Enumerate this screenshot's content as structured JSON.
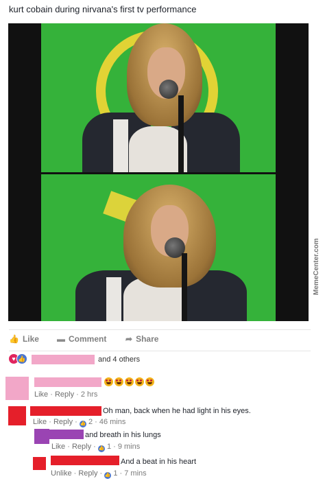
{
  "post": {
    "text": "kurt cobain during nirvana's first tv performance",
    "watermark": "MemeCenter.com"
  },
  "actions": {
    "like": "Like",
    "comment": "Comment",
    "share": "Share"
  },
  "reactions": {
    "others_text": "and 4 others",
    "icons": [
      "love-icon",
      "like-icon"
    ]
  },
  "comments": [
    {
      "text": "",
      "emojis": [
        "heart-eyes-emoji",
        "heart-eyes-emoji",
        "heart-eyes-emoji",
        "heart-eyes-emoji",
        "heart-eyes-emoji"
      ],
      "action_like": "Like",
      "action_reply": "Reply",
      "time": "2 hrs"
    },
    {
      "text": "Oh man, back when he had light in his eyes.",
      "action_like": "Like",
      "action_reply": "Reply",
      "likes": "2",
      "time": "46 mins"
    },
    {
      "text": "and breath in his lungs",
      "action_like": "Like",
      "action_reply": "Reply",
      "likes": "1",
      "time": "9 mins"
    },
    {
      "text": "And a beat in his heart",
      "action_like": "Unlike",
      "action_reply": "Reply",
      "likes": "1",
      "time": "7 mins"
    }
  ],
  "colors": {
    "green_screen": "#35b23a",
    "redact_pink": "#f2a7c8",
    "redact_red": "#e51f2a",
    "redact_purple": "#9a44b3",
    "link_blue": "#4a76d1"
  }
}
